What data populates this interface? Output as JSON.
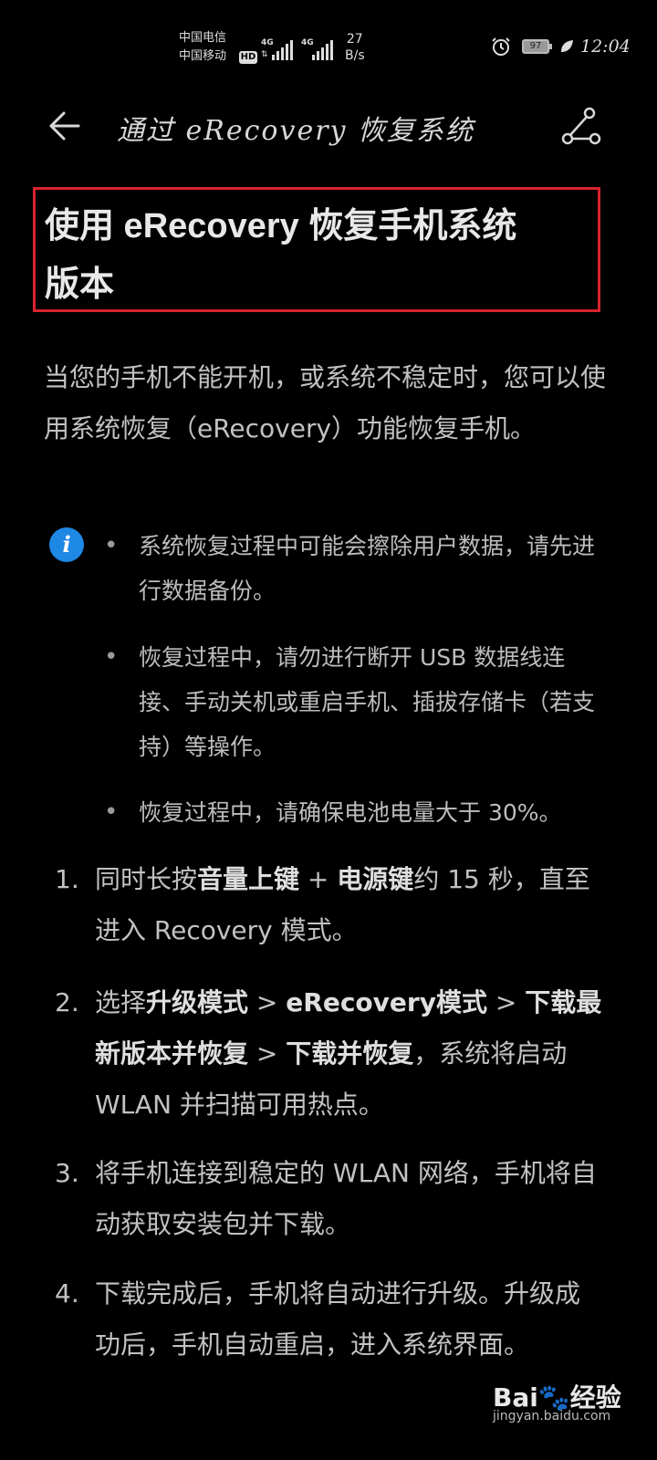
{
  "status_bar": {
    "carrier1": "中国电信",
    "carrier2": "中国移动",
    "hd_badge": "HD",
    "network1": "4G",
    "network2": "4G",
    "speed_value": "27",
    "speed_unit": "B/s",
    "battery_level": "97",
    "time": "12:04"
  },
  "header": {
    "title": "通过 eRecovery 恢复系统"
  },
  "article": {
    "title_line1": "使用 eRecovery 恢复手机系统",
    "title_line2": "版本",
    "intro": "当您的手机不能开机，或系统不稳定时，您可以使用系统恢复（eRecovery）功能恢复手机。",
    "notes": [
      "系统恢复过程中可能会擦除用户数据，请先进行数据备份。",
      "恢复过程中，请勿进行断开 USB 数据线连接、手动关机或重启手机、插拔存储卡（若支持）等操作。",
      "恢复过程中，请确保电池电量大于 30%。"
    ],
    "steps": [
      {
        "num": "1.",
        "t1": "同时长按",
        "b1": "音量上键",
        "t2": " + ",
        "b2": "电源键",
        "t3": "约 15 秒，直至进入 Recovery 模式。"
      },
      {
        "num": "2.",
        "t1": "选择",
        "b1": "升级模式",
        "t2": " > ",
        "b2": "eRecovery模式",
        "t3": " > ",
        "b3": "下载最新版本并恢复",
        "t4": " > ",
        "b4": "下载并恢复",
        "t5": "，系统将启动 WLAN 并扫描可用热点。"
      },
      {
        "num": "3.",
        "text": "将手机连接到稳定的 WLAN 网络，手机将自动获取安装包并下载。"
      },
      {
        "num": "4.",
        "text": "下载完成后，手机将自动进行升级。升级成功后，手机自动重启，进入系统界面。"
      }
    ]
  },
  "watermark": {
    "brand": "Bai",
    "brand2": "经验",
    "url": "jingyan.baidu.com"
  },
  "colors": {
    "background": "#000000",
    "text": "#c2c2c2",
    "highlight_border": "#d9232d",
    "info_icon": "#1e88e5"
  }
}
